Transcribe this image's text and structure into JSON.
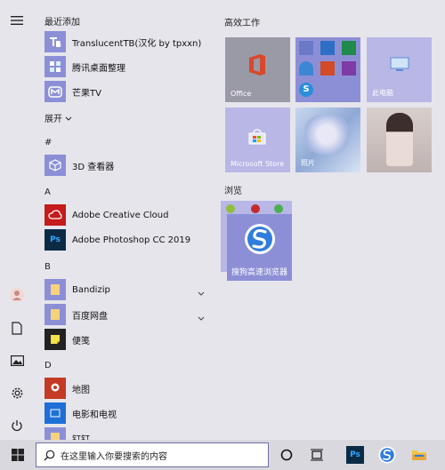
{
  "colors": {
    "tile_purple": "#8c8fd6",
    "tile_light": "#b9b7e6",
    "win_blue": "#2b7bd6",
    "office_red": "#d43b1c"
  },
  "app_list": {
    "recent_title": "最近添加",
    "recent": [
      {
        "label": "TranslucentTB(汉化 by tpxxn)",
        "icon": "translucenttb-icon"
      },
      {
        "label": "腾讯桌面整理",
        "icon": "tencent-desktop-icon"
      },
      {
        "label": "芒果TV",
        "icon": "mangotv-icon"
      }
    ],
    "expand_label": "展开",
    "letters": {
      "hash": "#",
      "a": "A",
      "b": "B",
      "d": "D"
    },
    "hash_apps": [
      {
        "label": "3D 查看器",
        "icon": "3d-viewer-icon"
      }
    ],
    "a_apps": [
      {
        "label": "Adobe Creative Cloud",
        "icon": "creative-cloud-icon"
      },
      {
        "label": "Adobe Photoshop CC 2019",
        "icon": "photoshop-icon"
      }
    ],
    "b_apps": [
      {
        "label": "Bandizip",
        "icon": "folder-icon"
      },
      {
        "label": "百度网盘",
        "icon": "folder-icon"
      },
      {
        "label": "便笺",
        "icon": "sticky-notes-icon"
      }
    ],
    "d_apps": [
      {
        "label": "地图",
        "icon": "maps-icon"
      },
      {
        "label": "电影和电视",
        "icon": "movies-tv-icon"
      },
      {
        "label": "钉钉",
        "icon": "folder-icon"
      }
    ]
  },
  "tiles": {
    "group1_title": "高效工作",
    "office_label": "Office",
    "thispc_label": "此电脑",
    "store_label": "Microsoft Store",
    "photos_label": "照片",
    "group2_title": "浏览",
    "sogou_label": "搜狗高速浏览器"
  },
  "taskbar": {
    "search_placeholder": "在这里输入你要搜索的内容"
  }
}
